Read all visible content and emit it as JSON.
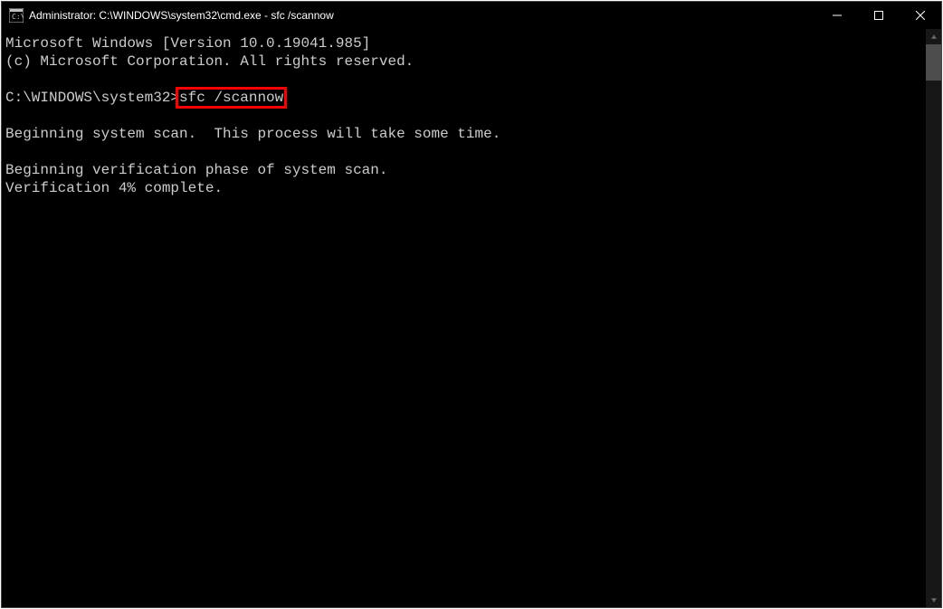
{
  "window": {
    "title": "Administrator: C:\\WINDOWS\\system32\\cmd.exe - sfc  /scannow"
  },
  "terminal": {
    "line1": "Microsoft Windows [Version 10.0.19041.985]",
    "line2": "(c) Microsoft Corporation. All rights reserved.",
    "blank1": "",
    "prompt1_prefix": "C:\\WINDOWS\\system32>",
    "prompt1_command": "sfc /scannow",
    "blank2": "",
    "line3": "Beginning system scan.  This process will take some time.",
    "blank3": "",
    "line4": "Beginning verification phase of system scan.",
    "line5": "Verification 4% complete."
  }
}
